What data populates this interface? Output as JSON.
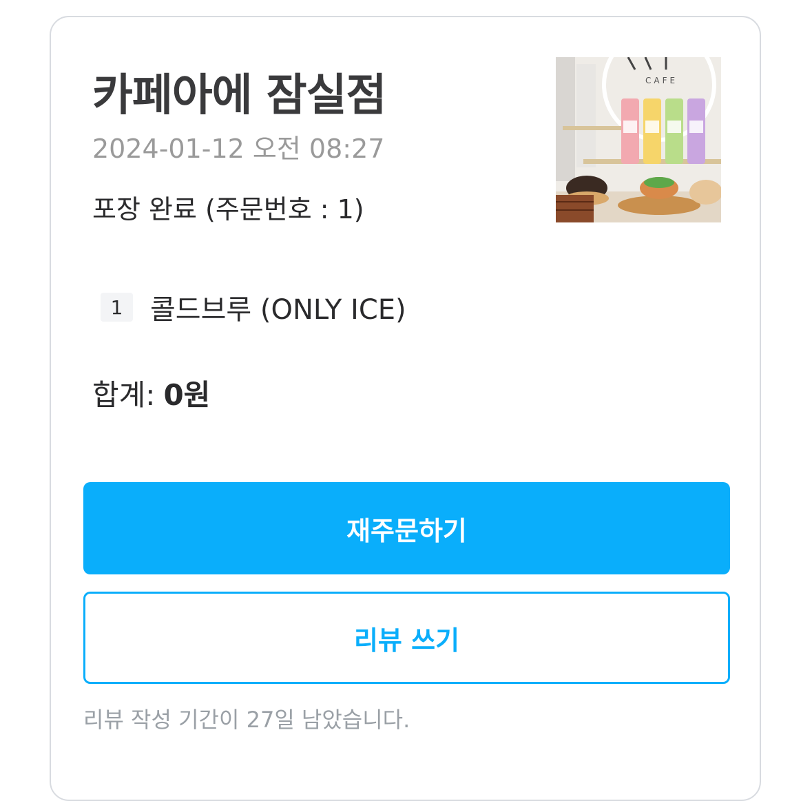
{
  "order": {
    "store_name": "카페아에 잠실점",
    "date": "2024-01-12 오전 08:27",
    "status": "포장 완료 (주문번호 : 1)",
    "thumbnail_text": "CAFE"
  },
  "items": [
    {
      "quantity": "1",
      "name": "콜드브루 (ONLY ICE)"
    }
  ],
  "total": {
    "label": "합계:",
    "value": "0원"
  },
  "actions": {
    "reorder_label": "재주문하기",
    "review_label": "리뷰 쓰기"
  },
  "review_note": "리뷰 작성 기간이 27일 남았습니다.",
  "colors": {
    "accent": "#0aaefb",
    "border": "#d8dbe0",
    "muted_text": "#9a9a9a"
  }
}
